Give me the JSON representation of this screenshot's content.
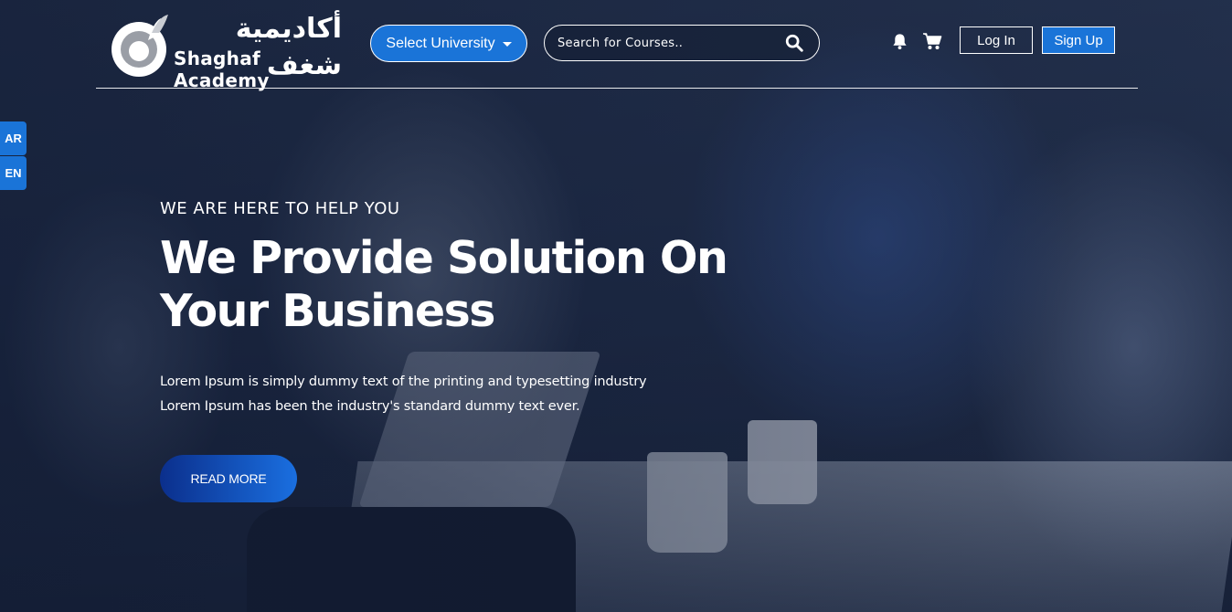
{
  "logo": {
    "arabic": "أكاديمية شغف",
    "latin": "Shaghaf Academy"
  },
  "header": {
    "select_university": "Select University",
    "search_placeholder": "Search for Courses..",
    "login": "Log In",
    "signup": "Sign Up"
  },
  "language": {
    "ar": "AR",
    "en": "EN"
  },
  "hero": {
    "eyebrow": "WE ARE HERE TO HELP YOU",
    "headline_line1": "We Provide Solution On",
    "headline_line2": "Your Business",
    "description_line1": "Lorem Ipsum is simply dummy text of the printing and typesetting industry",
    "description_line2": "Lorem Ipsum has been the industry's standard dummy text ever.",
    "cta": "READ MORE"
  },
  "icons": {
    "search": "search-icon",
    "bell": "bell-icon",
    "cart": "cart-icon",
    "caret": "chevron-down-icon"
  },
  "colors": {
    "accent": "#1a74d8",
    "cta_start": "#0b2f8c",
    "cta_end": "#1a6fe0",
    "overlay": "#121c34"
  }
}
